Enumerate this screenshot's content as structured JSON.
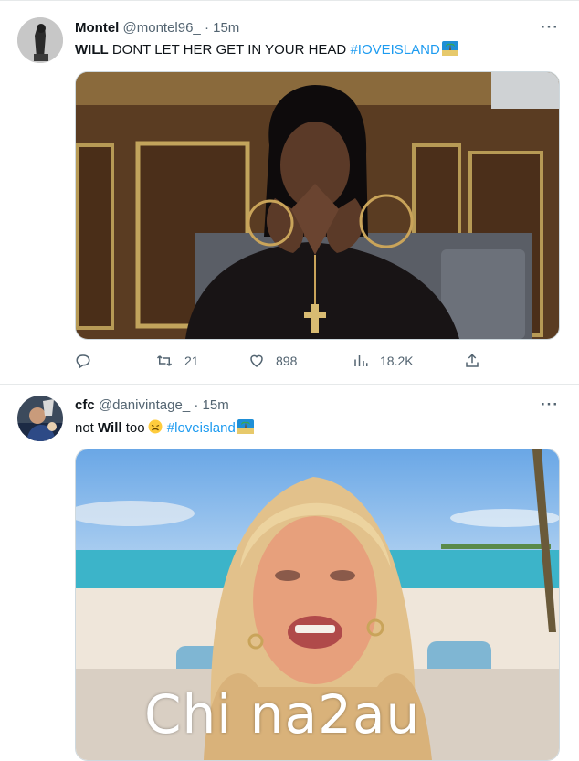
{
  "tweets": [
    {
      "name": "Montel",
      "handle": "@montel96_",
      "dot": "·",
      "time": "15m",
      "text_bold": "WILL",
      "text_rest": " DONT LET HER GET IN YOUR HEAD ",
      "hashtag": "#IOVEISLAND",
      "image_alt": "woman with hoop earrings and cross necklace, hands pressed together",
      "reply_count": "",
      "retweet_count": "21",
      "like_count": "898",
      "views_count": "18.2K"
    },
    {
      "name": "cfc",
      "handle": "@danivintage_",
      "dot": "·",
      "time": "15m",
      "text_plain": "not ",
      "text_bold": "Will",
      "text_rest": " too",
      "hashtag": "#loveisland",
      "image_alt": "crying blonde woman on beach villa set"
    }
  ],
  "more_glyph": "···",
  "watermark": "Chi na2au",
  "colors": {
    "accent": "#1d9bf0",
    "secondary_text": "#536471",
    "divider": "#e6e9ea"
  }
}
